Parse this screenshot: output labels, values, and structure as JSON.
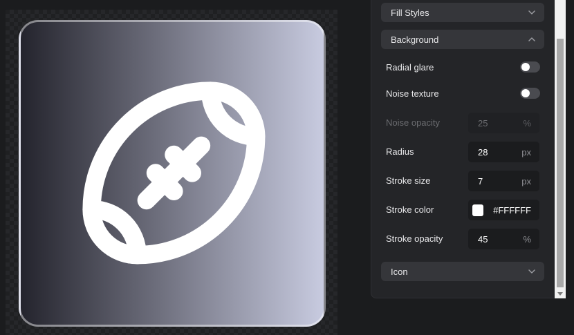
{
  "sections": {
    "fill_styles": "Fill Styles",
    "background": "Background",
    "icon": "Icon"
  },
  "background": {
    "radial_glare": {
      "label": "Radial glare",
      "on": false
    },
    "noise_texture": {
      "label": "Noise texture",
      "on": false
    },
    "noise_opacity": {
      "label": "Noise opacity",
      "value": "25",
      "unit": "%"
    },
    "radius": {
      "label": "Radius",
      "value": "28",
      "unit": "px"
    },
    "stroke_size": {
      "label": "Stroke size",
      "value": "7",
      "unit": "px"
    },
    "stroke_color": {
      "label": "Stroke color",
      "value": "#FFFFFF"
    },
    "stroke_opacity": {
      "label": "Stroke opacity",
      "value": "45",
      "unit": "%"
    }
  },
  "preview": {
    "icon_name": "football-icon",
    "gradient_colors": [
      "#24242d",
      "#6d6e7c",
      "#c8cbe0"
    ],
    "icon_color": "#ffffff"
  }
}
